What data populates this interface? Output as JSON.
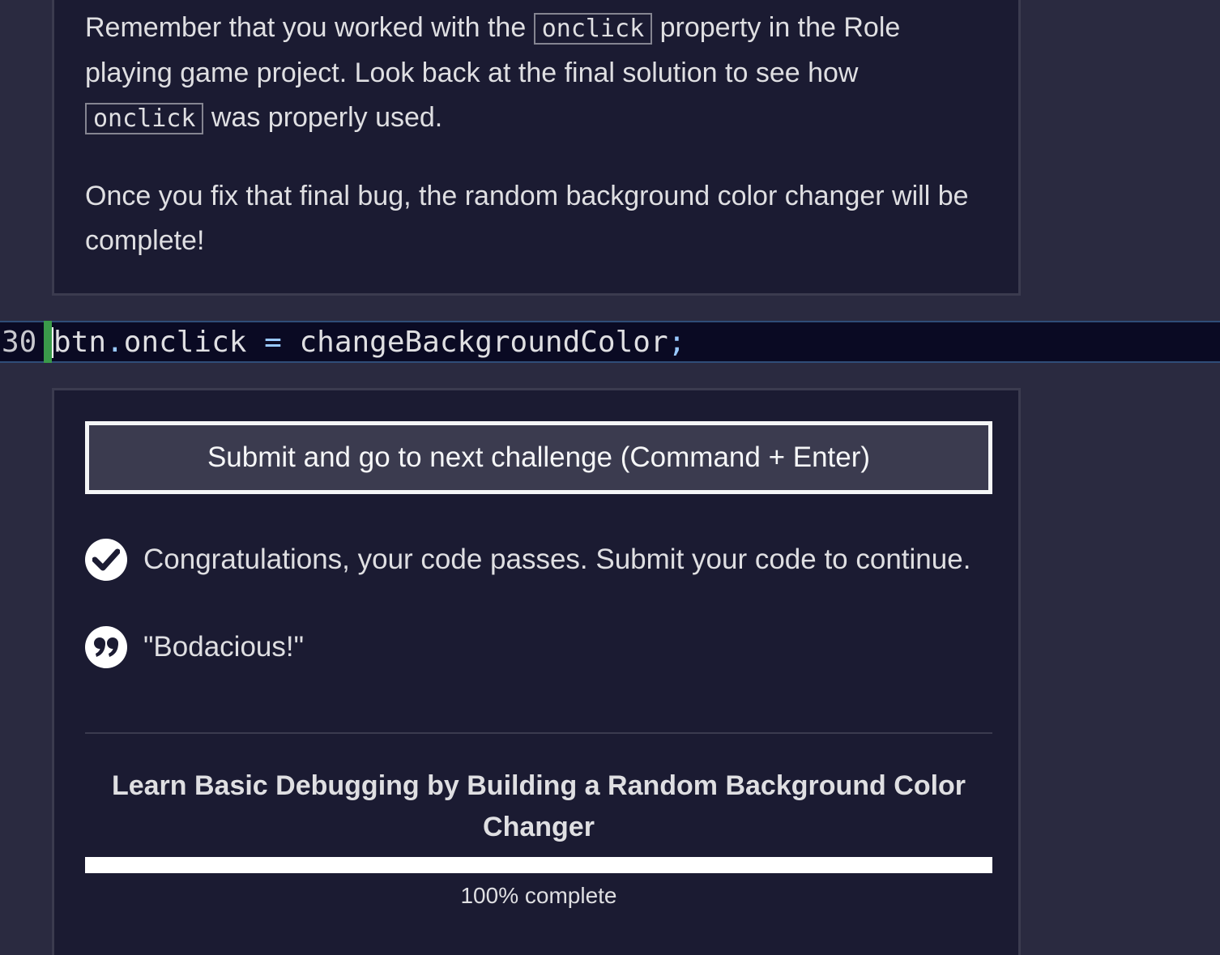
{
  "description": {
    "p1_before": "Remember that you worked with the ",
    "p1_code": "onclick",
    "p1_after": " property in the Role playing game project. Look back at the final solution to see how ",
    "p1_code2": "onclick",
    "p1_end": " was properly used.",
    "p2": "Once you fix that final bug, the random background color changer will be complete!"
  },
  "editor": {
    "line_number": "30",
    "code_obj": "btn",
    "code_dot": ".",
    "code_prop": "onclick",
    "code_eq": " = ",
    "code_fn": "changeBackgroundColor",
    "code_semi": ";"
  },
  "submit_button": {
    "label": "Submit and go to next challenge (Command + Enter)"
  },
  "results": {
    "pass_message": "Congratulations, your code passes. Submit your code to continue.",
    "quote": "\"Bodacious!\"",
    "pass_icon": "check-circle-icon",
    "quote_icon": "quote-icon"
  },
  "course": {
    "title": "Learn Basic Debugging by Building a Random Background Color Changer",
    "progress_percent": 100,
    "progress_label": "100% complete"
  },
  "colors": {
    "background": "#2a2a40",
    "panel": "#1b1b32",
    "editor_line": "#0a0a23",
    "gutter_marker": "#3a9a4a"
  }
}
